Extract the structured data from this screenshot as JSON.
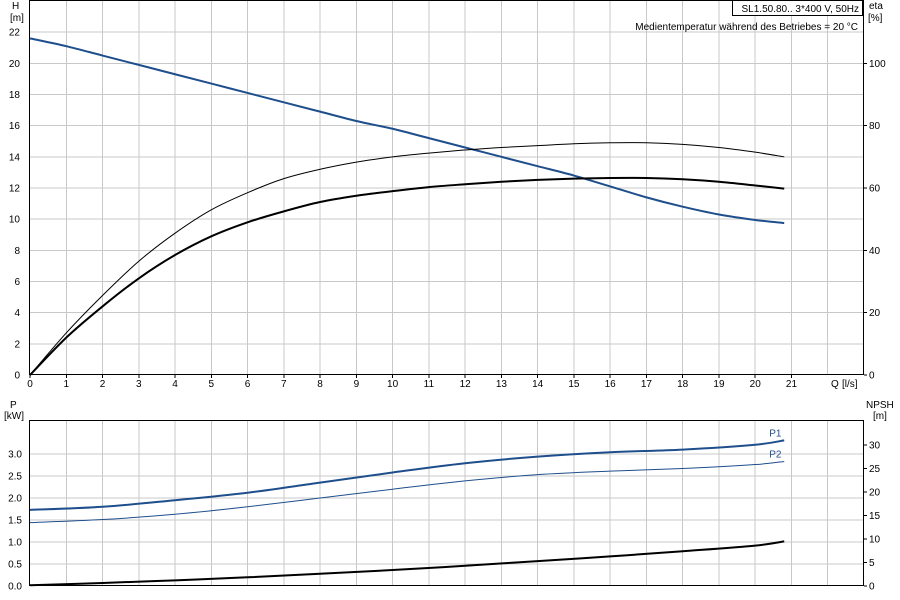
{
  "chart_data": [
    {
      "type": "line",
      "title": "SL1.50.80.. 3*400 V, 50Hz",
      "subtitle": "Medientemperatur während des Betriebes = 20 °C",
      "ylabel_left": "H",
      "ylabel_left_unit": "[m]",
      "ylabel_right": "eta",
      "ylabel_right_unit": "[%]",
      "xlabel": "Q",
      "xlabel_unit": "[l/s]",
      "xlim": [
        0,
        23
      ],
      "ylim_left": [
        0,
        24
      ],
      "ylim_right_ticks": [
        0,
        20,
        40,
        60,
        80,
        100
      ],
      "x_ticks": [
        0,
        1,
        2,
        3,
        4,
        5,
        6,
        7,
        8,
        9,
        10,
        11,
        12,
        13,
        14,
        15,
        16,
        17,
        18,
        19,
        20,
        21
      ],
      "y_ticks_left": [
        0,
        2,
        4,
        6,
        8,
        10,
        12,
        14,
        16,
        18,
        20,
        22
      ],
      "grid": true,
      "series": [
        {
          "kind": "H",
          "axis": "left",
          "color": "#1f4e8c",
          "x": [
            0,
            1,
            2,
            3,
            4,
            5,
            6,
            7,
            8,
            9,
            10,
            11,
            12,
            13,
            14,
            15,
            16,
            17,
            18,
            19,
            20,
            20.8
          ],
          "y": [
            21.6,
            21.1,
            20.5,
            19.9,
            19.3,
            18.7,
            18.1,
            17.5,
            16.9,
            16.3,
            15.8,
            15.2,
            14.6,
            14.0,
            13.4,
            12.8,
            12.1,
            11.4,
            10.8,
            10.3,
            9.95,
            9.75
          ]
        },
        {
          "kind": "eta",
          "axis": "right",
          "color": "#000000",
          "width": 1,
          "x": [
            0,
            1,
            2,
            3,
            4,
            5,
            6,
            7,
            8,
            9,
            10,
            11,
            12,
            13,
            14,
            15,
            16,
            17,
            18,
            19,
            20,
            20.8
          ],
          "y": [
            0,
            13.5,
            25.5,
            36.5,
            45.5,
            53,
            58.5,
            63,
            66,
            68.3,
            70,
            71.2,
            72.2,
            73,
            73.6,
            74.2,
            74.5,
            74.5,
            74,
            73,
            71.5,
            70
          ]
        },
        {
          "kind": "eta",
          "axis": "right",
          "color": "#000000",
          "width": 2,
          "x": [
            0,
            1,
            2,
            3,
            4,
            5,
            6,
            7,
            8,
            9,
            10,
            11,
            12,
            13,
            14,
            15,
            16,
            17,
            18,
            19,
            20,
            20.8
          ],
          "y": [
            0,
            12,
            22,
            31,
            38.5,
            44.5,
            49,
            52.5,
            55.5,
            57.5,
            59,
            60.3,
            61.2,
            62,
            62.6,
            63,
            63.2,
            63.2,
            62.8,
            62,
            60.8,
            59.8
          ]
        }
      ]
    },
    {
      "type": "line",
      "ylabel_left": "P",
      "ylabel_left_unit": "[kW]",
      "ylabel_right": "NPSH",
      "ylabel_right_unit": "[m]",
      "xlim": [
        0,
        23
      ],
      "ylim_left": [
        0,
        3.75
      ],
      "y_ticks_left": [
        "0.0",
        "0.5",
        "1.0",
        "1.5",
        "2.0",
        "2.5",
        "3.0"
      ],
      "y_ticks_right": [
        0,
        5,
        10,
        15,
        20,
        25,
        30
      ],
      "grid": true,
      "series": [
        {
          "name": "P1",
          "axis": "left",
          "color": "#1f4e8c",
          "width": 2,
          "x": [
            0,
            2,
            4,
            6,
            8,
            10,
            12,
            14,
            16,
            18,
            20,
            20.8
          ],
          "y": [
            1.73,
            1.8,
            1.95,
            2.12,
            2.35,
            2.58,
            2.79,
            2.94,
            3.04,
            3.1,
            3.21,
            3.31
          ]
        },
        {
          "name": "P2",
          "axis": "left",
          "color": "#1f4e8c",
          "width": 1,
          "x": [
            0,
            2,
            4,
            6,
            8,
            10,
            12,
            14,
            16,
            18,
            20,
            20.8
          ],
          "y": [
            1.44,
            1.51,
            1.63,
            1.8,
            2.0,
            2.2,
            2.39,
            2.53,
            2.61,
            2.67,
            2.76,
            2.83
          ]
        },
        {
          "kind": "NPSH",
          "axis": "right",
          "color": "#000000",
          "width": 2,
          "x": [
            0,
            2,
            4,
            6,
            8,
            10,
            12,
            14,
            16,
            18,
            20,
            20.8
          ],
          "y": [
            0.15,
            0.65,
            1.2,
            1.85,
            2.6,
            3.4,
            4.3,
            5.3,
            6.3,
            7.4,
            8.6,
            9.5
          ]
        }
      ]
    }
  ]
}
